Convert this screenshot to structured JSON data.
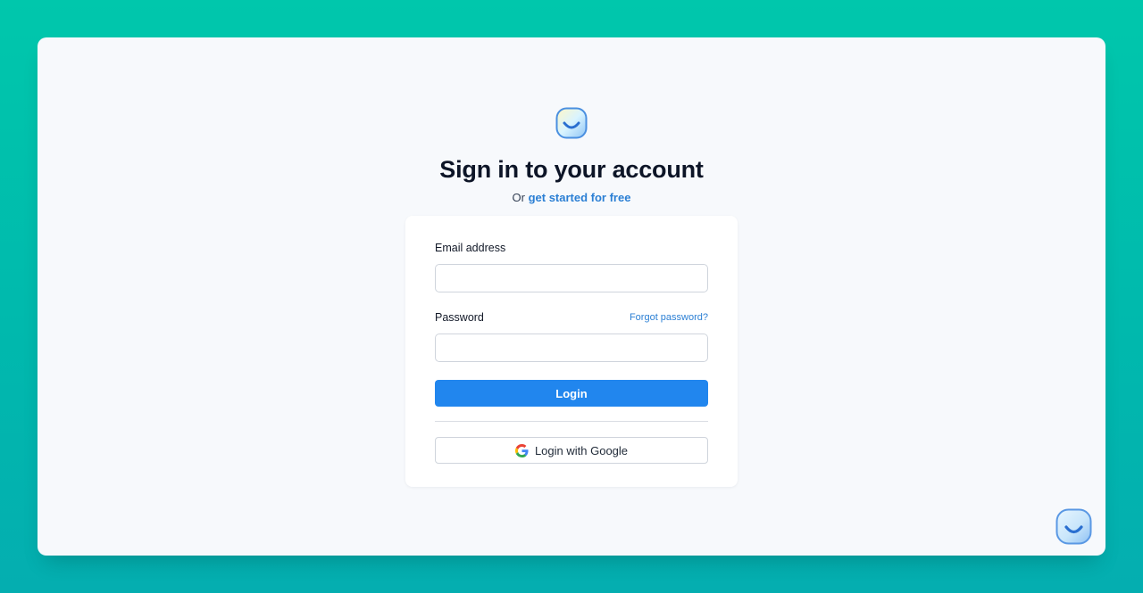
{
  "page": {
    "title": "Sign in to your account",
    "subtitle_prefix": "Or",
    "subtitle_link": "get started for free"
  },
  "form": {
    "email_label": "Email address",
    "email_value": "",
    "email_placeholder": "",
    "password_label": "Password",
    "password_value": "",
    "password_placeholder": "",
    "forgot_password": "Forgot password?",
    "login_button": "Login",
    "google_button": "Login with Google"
  },
  "icons": {
    "logo": "smiley-logo-icon",
    "google": "google-icon",
    "chat": "chat-widget-icon"
  },
  "colors": {
    "background": "#00c1ac",
    "panel": "#f7f9fc",
    "primary_button": "#2186ee",
    "link": "#2b7fd4"
  }
}
